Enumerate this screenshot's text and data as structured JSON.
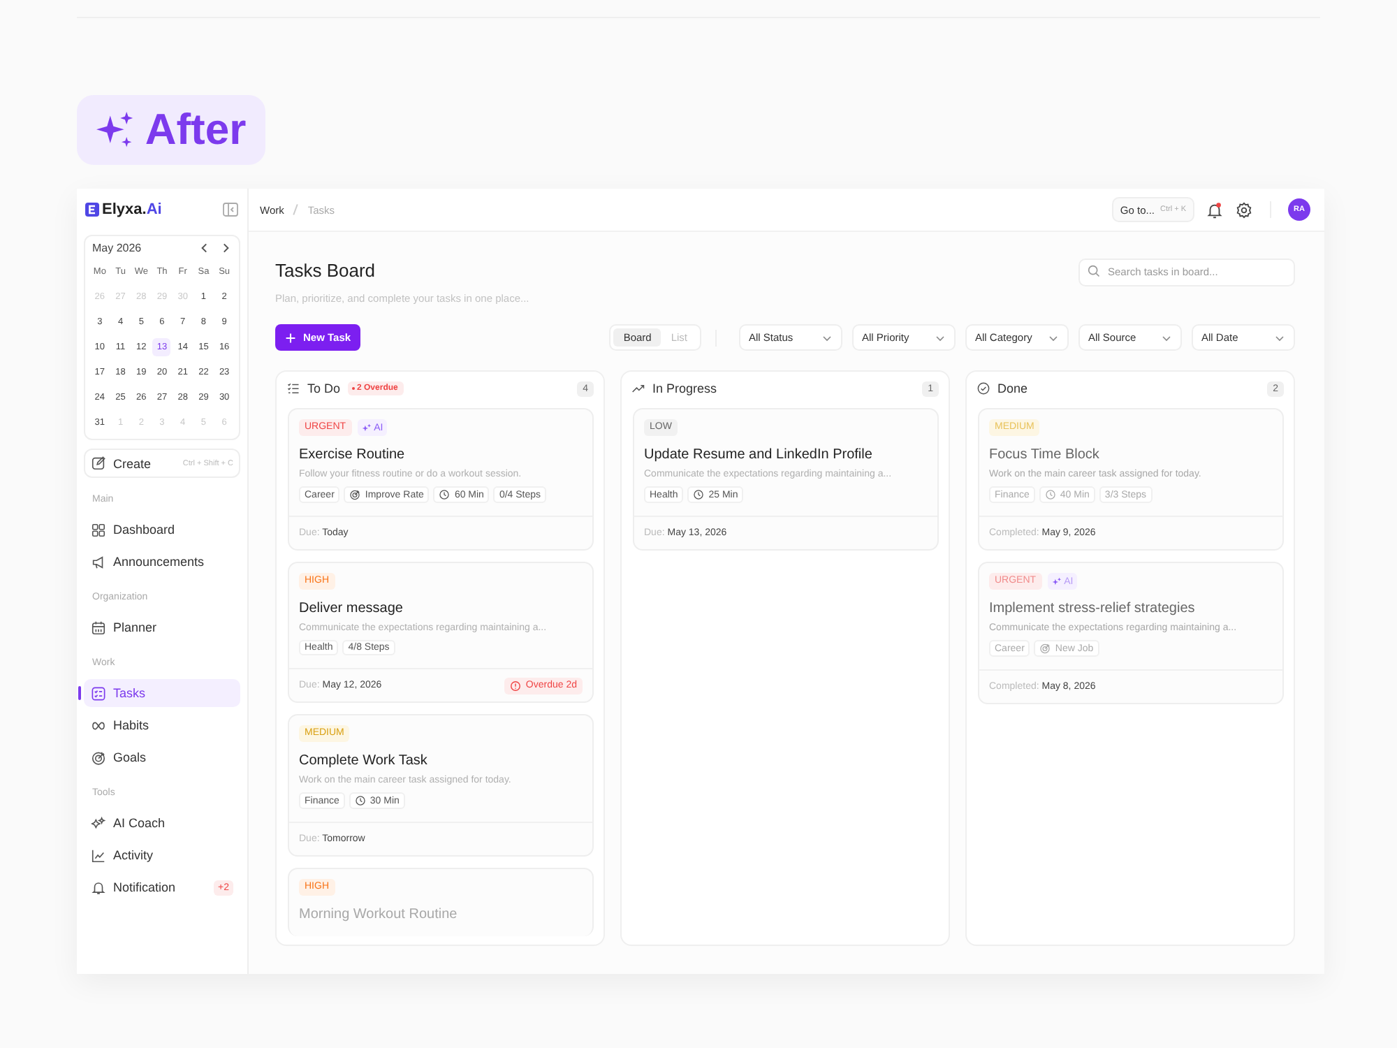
{
  "badge": {
    "label": "After"
  },
  "brand": {
    "name": "Elyxa.",
    "accent": "Ai"
  },
  "calendar": {
    "month": "May 2026",
    "weekdays": [
      "Mo",
      "Tu",
      "We",
      "Th",
      "Fr",
      "Sa",
      "Su"
    ],
    "weeks": [
      [
        {
          "label": "26",
          "muted": true,
          "selected": false
        },
        {
          "label": "27",
          "muted": true,
          "selected": false
        },
        {
          "label": "28",
          "muted": true,
          "selected": false
        },
        {
          "label": "29",
          "muted": true,
          "selected": false
        },
        {
          "label": "30",
          "muted": true,
          "selected": false
        },
        {
          "label": "1",
          "muted": false,
          "selected": false
        },
        {
          "label": "2",
          "muted": false,
          "selected": false
        }
      ],
      [
        {
          "label": "3",
          "muted": false,
          "selected": false
        },
        {
          "label": "4",
          "muted": false,
          "selected": false
        },
        {
          "label": "5",
          "muted": false,
          "selected": false
        },
        {
          "label": "6",
          "muted": false,
          "selected": false
        },
        {
          "label": "7",
          "muted": false,
          "selected": false
        },
        {
          "label": "8",
          "muted": false,
          "selected": false
        },
        {
          "label": "9",
          "muted": false,
          "selected": false
        }
      ],
      [
        {
          "label": "10",
          "muted": false,
          "selected": false
        },
        {
          "label": "11",
          "muted": false,
          "selected": false
        },
        {
          "label": "12",
          "muted": false,
          "selected": false
        },
        {
          "label": "13",
          "muted": false,
          "selected": true
        },
        {
          "label": "14",
          "muted": false,
          "selected": false
        },
        {
          "label": "15",
          "muted": false,
          "selected": false
        },
        {
          "label": "16",
          "muted": false,
          "selected": false
        }
      ],
      [
        {
          "label": "17",
          "muted": false,
          "selected": false
        },
        {
          "label": "18",
          "muted": false,
          "selected": false
        },
        {
          "label": "19",
          "muted": false,
          "selected": false
        },
        {
          "label": "20",
          "muted": false,
          "selected": false
        },
        {
          "label": "21",
          "muted": false,
          "selected": false
        },
        {
          "label": "22",
          "muted": false,
          "selected": false
        },
        {
          "label": "23",
          "muted": false,
          "selected": false
        }
      ],
      [
        {
          "label": "24",
          "muted": false,
          "selected": false
        },
        {
          "label": "25",
          "muted": false,
          "selected": false
        },
        {
          "label": "26",
          "muted": false,
          "selected": false
        },
        {
          "label": "27",
          "muted": false,
          "selected": false
        },
        {
          "label": "28",
          "muted": false,
          "selected": false
        },
        {
          "label": "29",
          "muted": false,
          "selected": false
        },
        {
          "label": "30",
          "muted": false,
          "selected": false
        }
      ],
      [
        {
          "label": "31",
          "muted": false,
          "selected": false
        },
        {
          "label": "1",
          "muted": true,
          "selected": false
        },
        {
          "label": "2",
          "muted": true,
          "selected": false
        },
        {
          "label": "3",
          "muted": true,
          "selected": false
        },
        {
          "label": "4",
          "muted": true,
          "selected": false
        },
        {
          "label": "5",
          "muted": true,
          "selected": false
        },
        {
          "label": "6",
          "muted": true,
          "selected": false
        }
      ]
    ]
  },
  "create": {
    "label": "Create",
    "shortcut": "Ctrl + Shift + C"
  },
  "nav": [
    {
      "title": "Main",
      "items": [
        {
          "label": "Dashboard",
          "kind": "dashboard",
          "selected": false
        },
        {
          "label": "Announcements",
          "kind": "announcements",
          "selected": false
        }
      ]
    },
    {
      "title": "Organization",
      "items": [
        {
          "label": "Planner",
          "kind": "planner",
          "selected": false
        }
      ]
    },
    {
      "title": "Work",
      "items": [
        {
          "label": "Tasks",
          "kind": "tasks",
          "selected": true
        },
        {
          "label": "Habits",
          "kind": "habits",
          "selected": false
        },
        {
          "label": "Goals",
          "kind": "goals",
          "selected": false
        }
      ]
    },
    {
      "title": "Tools",
      "items": [
        {
          "label": "AI Coach",
          "kind": "ai",
          "selected": false
        },
        {
          "label": "Activity",
          "kind": "activity",
          "selected": false
        },
        {
          "label": "Notification",
          "kind": "notification",
          "selected": false,
          "badge": "+2"
        }
      ]
    }
  ],
  "breadcrumb": [
    "Work",
    "Tasks"
  ],
  "goto": {
    "label": "Go to...",
    "shortcut": "Ctrl + K"
  },
  "notifications": {
    "unread": true
  },
  "avatar": "RA",
  "title": "Tasks Board",
  "subtitle": "Plan, prioritize, and complete your tasks in one place...",
  "search": {
    "placeholder": "Search tasks in board..."
  },
  "new_task": "New Task",
  "views": [
    {
      "label": "Board",
      "selected": true
    },
    {
      "label": "List",
      "selected": false
    }
  ],
  "filters": [
    "All Status",
    "All Priority",
    "All Category",
    "All Source",
    "All Date"
  ],
  "columns": [
    {
      "title": "To Do",
      "kind": "todo",
      "overdue": "2 Overdue",
      "count": "4",
      "cards": [
        {
          "priority": {
            "label": "URGENT",
            "kind": "urgent"
          },
          "ai": "AI",
          "title": "Exercise Routine",
          "description": "Follow your fitness routine or do a workout session.",
          "tags": [
            {
              "label": "Career",
              "kind": "plain"
            },
            {
              "label": "Improve Rate",
              "kind": "goal"
            },
            {
              "label": "60 Min",
              "kind": "time"
            },
            {
              "label": "0/4 Steps",
              "kind": "plain"
            }
          ],
          "date_label": "Due:",
          "date": "Today"
        },
        {
          "priority": {
            "label": "HIGH",
            "kind": "high"
          },
          "title": "Deliver message",
          "description": "Communicate the expectations regarding maintaining a...",
          "tags": [
            {
              "label": "Health",
              "kind": "plain"
            },
            {
              "label": "4/8 Steps",
              "kind": "plain"
            }
          ],
          "date_label": "Due:",
          "date": "May 12, 2026",
          "overdue": "Overdue 2d"
        },
        {
          "priority": {
            "label": "MEDIUM",
            "kind": "medium"
          },
          "title": "Complete Work Task",
          "description": "Work on the main career task assigned for today.",
          "tags": [
            {
              "label": "Finance",
              "kind": "plain"
            },
            {
              "label": "30 Min",
              "kind": "time"
            }
          ],
          "date_label": "Due:",
          "date": "Tomorrow"
        },
        {
          "priority": {
            "label": "HIGH",
            "kind": "high"
          },
          "title": "Morning Workout Routine",
          "partial": true
        }
      ]
    },
    {
      "title": "In Progress",
      "kind": "progress",
      "count": "1",
      "cards": [
        {
          "priority": {
            "label": "LOW",
            "kind": "low"
          },
          "title": "Update Resume and LinkedIn Profile",
          "description": "Communicate the expectations regarding maintaining a...",
          "tags": [
            {
              "label": "Health",
              "kind": "plain"
            },
            {
              "label": "25 Min",
              "kind": "time"
            }
          ],
          "date_label": "Due:",
          "date": "May 13, 2026"
        }
      ]
    },
    {
      "title": "Done",
      "kind": "done",
      "count": "2",
      "cards": [
        {
          "priority": {
            "label": "MEDIUM",
            "kind": "medium"
          },
          "title": "Focus Time Block",
          "description": "Work on the main career task assigned for today.",
          "tags": [
            {
              "label": "Finance",
              "kind": "plain"
            },
            {
              "label": "40 Min",
              "kind": "time"
            },
            {
              "label": "3/3 Steps",
              "kind": "plain"
            }
          ],
          "date_label": "Completed:",
          "date": "May 9, 2026"
        },
        {
          "priority": {
            "label": "URGENT",
            "kind": "urgent"
          },
          "ai": "AI",
          "title": "Implement stress-relief strategies",
          "description": "Communicate the expectations regarding maintaining a...",
          "tags": [
            {
              "label": "Career",
              "kind": "plain"
            },
            {
              "label": "New Job",
              "kind": "goal"
            }
          ],
          "date_label": "Completed:",
          "date": "May 8, 2026"
        }
      ]
    }
  ]
}
